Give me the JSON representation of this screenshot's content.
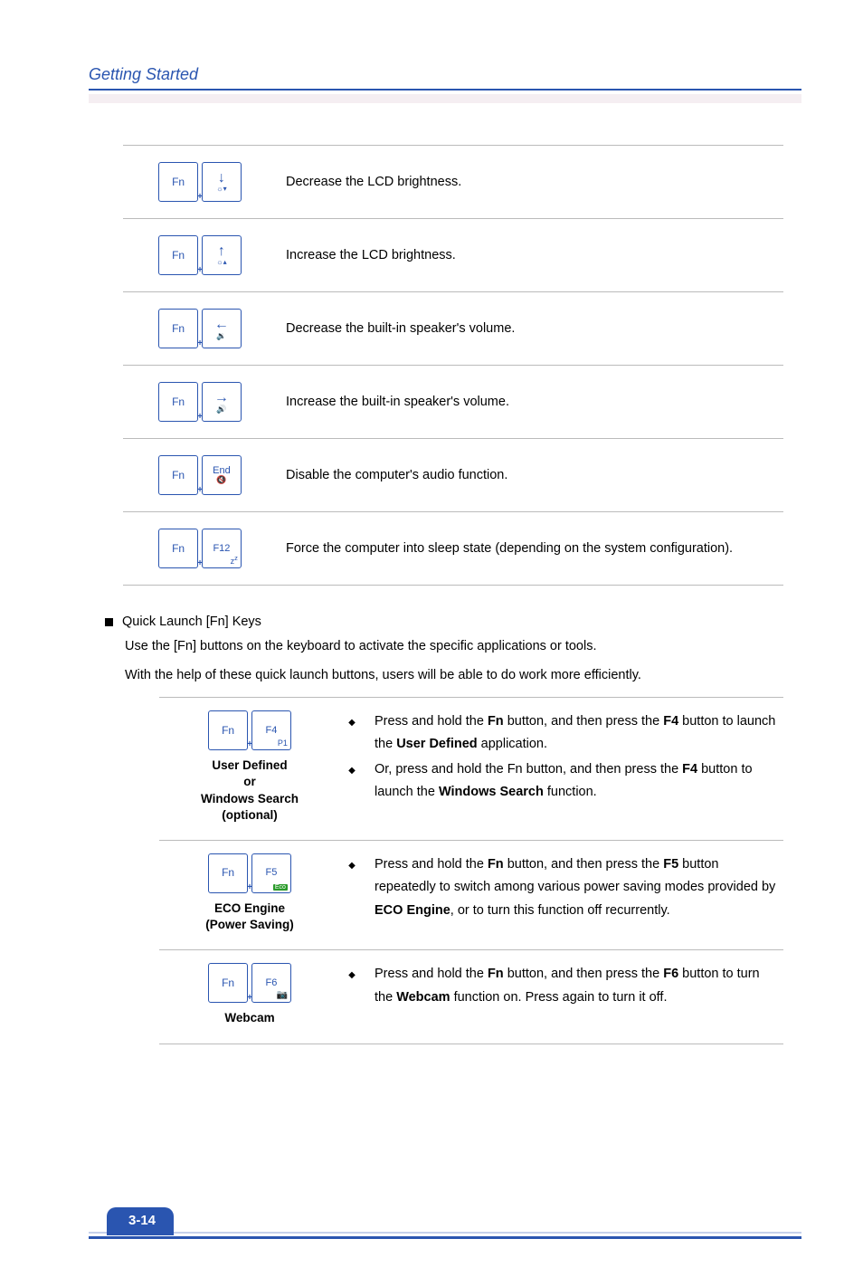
{
  "header": {
    "title": "Getting Started"
  },
  "fn_rows": [
    {
      "desc": "Decrease the LCD brightness."
    },
    {
      "desc": "Increase the LCD brightness."
    },
    {
      "desc": "Decrease the built-in speaker's volume."
    },
    {
      "desc": "Increase the built-in speaker's volume."
    },
    {
      "desc": "Disable the computer's audio function."
    },
    {
      "desc": "Force the computer into sleep state (depending on the system configuration)."
    }
  ],
  "keys": {
    "fn": "Fn",
    "end": "End",
    "f12": "F12",
    "zz": "z",
    "f4": "F4",
    "p1": "P1",
    "f5": "F5",
    "eco": "Eco",
    "f6": "F6"
  },
  "quick_launch": {
    "heading": "Quick Launch [Fn] Keys",
    "para1": "Use the [Fn] buttons on the keyboard to activate the specific applications or tools.",
    "para2": "With the help of these quick launch buttons, users will be able to do work more efficiently."
  },
  "ql_rows": [
    {
      "label_lines": [
        "User Defined",
        "or",
        "Windows Search",
        "(optional)"
      ],
      "bullets": [
        {
          "pre": "Press and hold the ",
          "b1": "Fn",
          "mid1": " button, and then press the ",
          "b2": "F4",
          "mid2": " button to launch the ",
          "b3": "User Defined",
          "post": " application."
        },
        {
          "pre": "Or, press and hold the Fn button, and then press the ",
          "b1": "F4",
          "mid1": " button to launch the ",
          "b2": "Windows Search",
          "post": " function."
        }
      ]
    },
    {
      "label_lines": [
        "ECO Engine",
        "(Power Saving)"
      ],
      "bullets": [
        {
          "pre": "Press and hold the ",
          "b1": "Fn",
          "mid1": " button, and then press the ",
          "b2": "F5",
          "mid2": " button repeatedly to switch among various power saving modes provided by ",
          "b3": "ECO Engine",
          "post": ", or to turn this function off recurrently."
        }
      ]
    },
    {
      "label_lines": [
        "Webcam"
      ],
      "bullets": [
        {
          "pre": "Press and hold the ",
          "b1": "Fn",
          "mid1": " button, and then press the ",
          "b2": "F6",
          "mid2": " button to turn the ",
          "b3": "Webcam",
          "post": " function on. Press again to turn it off."
        }
      ]
    }
  ],
  "page_number": "3-14"
}
